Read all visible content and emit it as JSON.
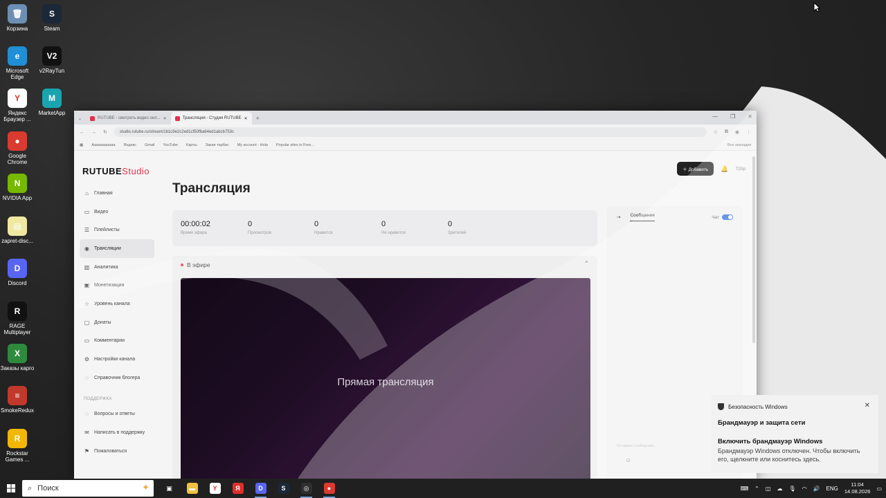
{
  "desktop_icons": [
    {
      "label": "Корзина",
      "color": "#6c8fb3",
      "glyph": "🗑",
      "icon": "recycle-bin-icon"
    },
    {
      "label": "Steam",
      "color": "#1b2838",
      "glyph": "S",
      "icon": "steam-icon"
    },
    {
      "label": "Microsoft Edge",
      "color": "#1f8fd6",
      "glyph": "e",
      "icon": "edge-icon"
    },
    {
      "label": "v2RayTun",
      "color": "#111111",
      "glyph": "V2",
      "icon": "v2raytun-icon"
    },
    {
      "label": "Яндекс Браузер ...",
      "color": "#ffffff",
      "glyph": "Y",
      "icon": "yandex-browser-icon"
    },
    {
      "label": "MarketApp",
      "color": "#1aa4b0",
      "glyph": "M",
      "icon": "marketapp-icon"
    },
    {
      "label": "Google Chrome",
      "color": "#d93b30",
      "glyph": "●",
      "icon": "chrome-icon"
    },
    {
      "label": "NVIDIA App",
      "color": "#76b900",
      "glyph": "N",
      "icon": "nvidia-icon"
    },
    {
      "label": "zapret-disc...",
      "color": "#f0e8a0",
      "glyph": "▤",
      "icon": "folder-icon"
    },
    {
      "label": "Discord",
      "color": "#5865f2",
      "glyph": "D",
      "icon": "discord-icon"
    },
    {
      "label": "RAGE Multiplayer",
      "color": "#111111",
      "glyph": "R",
      "icon": "rage-icon"
    },
    {
      "label": "Заказы карго",
      "color": "#2e8b3e",
      "glyph": "X",
      "icon": "excel-icon"
    },
    {
      "label": "SmokeRedux",
      "color": "#c0392b",
      "glyph": "≡",
      "icon": "winrar-icon"
    },
    {
      "label": "Rockstar Games ...",
      "color": "#f2b705",
      "glyph": "R",
      "icon": "rockstar-icon"
    }
  ],
  "browser": {
    "tabs": [
      {
        "label": "RUTUBE - смотреть видео онл..."
      },
      {
        "label": "Трансляция - Студия RUTUBE"
      }
    ],
    "url": "studio.rutube.ru/stream/1b1c9e2c2ed1cf50f6a64ed1abcb753c",
    "bookmarks": [
      "Ааааааааааа",
      "Яндекс",
      "Gmail",
      "YouTube",
      "Карты",
      "Закап тарбас",
      "My account - Hola",
      "Popular sites in Free..."
    ],
    "bookmarks_right": "Все закладки"
  },
  "studio": {
    "logo_main": "RUTUBE",
    "logo_suffix": "Studio",
    "add_button": "Добавить",
    "quality": "720p",
    "nav": [
      {
        "label": "Главная",
        "glyph": "⌂",
        "icon": "home-icon"
      },
      {
        "label": "Видео",
        "glyph": "▭",
        "icon": "video-icon"
      },
      {
        "label": "Плейлисты",
        "glyph": "☰",
        "icon": "playlist-icon"
      },
      {
        "label": "Трансляции",
        "glyph": "◉",
        "icon": "broadcast-icon",
        "active": true
      },
      {
        "label": "Аналитика",
        "glyph": "▥",
        "icon": "analytics-icon"
      },
      {
        "label": "Монетизация",
        "glyph": "▣",
        "icon": "monetization-icon"
      },
      {
        "label": "Уровень канала",
        "glyph": "☆",
        "icon": "star-icon"
      },
      {
        "label": "Донаты",
        "glyph": "▢",
        "icon": "donate-icon"
      },
      {
        "label": "Комментарии",
        "glyph": "▭",
        "icon": "comments-icon"
      },
      {
        "label": "Настройки канала",
        "glyph": "⚙",
        "icon": "gear-icon"
      },
      {
        "label": "Справочник блогера",
        "glyph": "◌",
        "icon": "guide-icon"
      }
    ],
    "support_section": "ПОДДЕРЖКА",
    "support_nav": [
      {
        "label": "Вопросы и ответы",
        "glyph": "◌",
        "icon": "faq-icon"
      },
      {
        "label": "Написать в поддержку",
        "glyph": "✉",
        "icon": "mail-icon"
      },
      {
        "label": "Пожаловаться",
        "glyph": "⚑",
        "icon": "flag-icon"
      }
    ],
    "page_title": "Трансляция",
    "stats": [
      {
        "value": "00:00:02",
        "label": "Время эфира"
      },
      {
        "value": "0",
        "label": "Просмотров"
      },
      {
        "value": "0",
        "label": "Нравится"
      },
      {
        "value": "0",
        "label": "Не нравится"
      },
      {
        "value": "0",
        "label": "Зрителей"
      }
    ],
    "live_label": "В эфире",
    "video_text": "Прямая трансляция",
    "chat_tab": "Сообщения",
    "chat_toggle_label": "Чат",
    "chat_placeholder": "Оставьте сообщение..."
  },
  "notification": {
    "app": "Безопасность Windows",
    "title": "Брандмауэр и защита сети",
    "heading": "Включить брандмауэр Windows",
    "body": "Брандмауэр Windows отключен. Чтобы включить его, щелкните или коснитесь здесь."
  },
  "taskbar": {
    "search_placeholder": "Поиск",
    "apps": [
      {
        "icon": "task-view-icon",
        "color": "#202020",
        "glyph": "▣"
      },
      {
        "icon": "file-explorer-icon",
        "color": "#f0c040",
        "glyph": "▬"
      },
      {
        "icon": "yandex-browser-icon",
        "color": "#ffffff",
        "glyph": "Y"
      },
      {
        "icon": "yandex-icon",
        "color": "#e0302a",
        "glyph": "Я"
      },
      {
        "icon": "discord-icon",
        "color": "#5865f2",
        "glyph": "D",
        "running": true
      },
      {
        "icon": "steam-icon",
        "color": "#1b2838",
        "glyph": "S"
      },
      {
        "icon": "obs-icon",
        "color": "#302e31",
        "glyph": "◎",
        "running": true
      },
      {
        "icon": "chrome-icon",
        "color": "#d93b30",
        "glyph": "●",
        "running": true
      }
    ],
    "language": "ENG",
    "time": "11:04",
    "date": "14.08.2026"
  }
}
